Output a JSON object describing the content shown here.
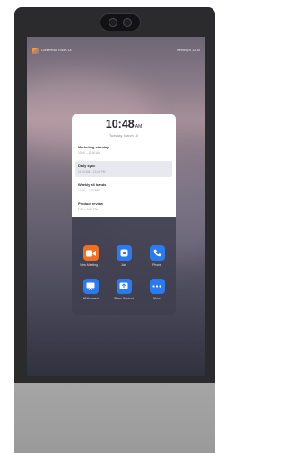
{
  "status_bar": {
    "left_text": "Conference Room 1A",
    "right_text": "Meeting in 12:15"
  },
  "clock": {
    "time": "10:48",
    "ampm": "AM",
    "date": "Tuesday, March 10"
  },
  "events": [
    {
      "title": "Marketing standup",
      "time": "10:00 – 11:00 AM"
    },
    {
      "title": "Daily sync",
      "time": "11:00 AM – 12:00 PM"
    },
    {
      "title": "Weekly all hands",
      "time": "12:00 – 1:00 PM"
    },
    {
      "title": "Product review",
      "time": "2:00 – 3:00 PM"
    }
  ],
  "actions": [
    {
      "label": "New Meeting ⌄",
      "icon": "video-camera-icon",
      "color": "#f26f21"
    },
    {
      "label": "Join",
      "icon": "join-icon",
      "color": "#2a7bf2"
    },
    {
      "label": "Phone",
      "icon": "phone-icon",
      "color": "#2a7bf2"
    },
    {
      "label": "Whiteboard",
      "icon": "whiteboard-icon",
      "color": "#2a7bf2"
    },
    {
      "label": "Share Content",
      "icon": "share-screen-icon",
      "color": "#2a7bf2"
    },
    {
      "label": "More",
      "icon": "more-icon",
      "color": "#2a7bf2"
    }
  ]
}
